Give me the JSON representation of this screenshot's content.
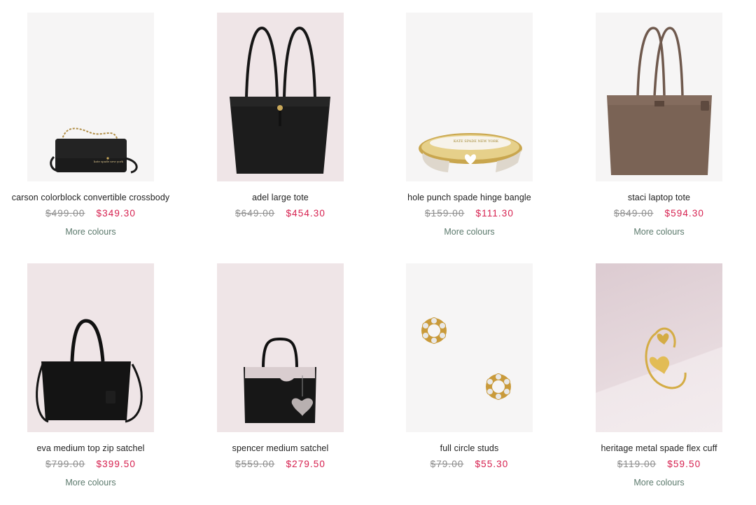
{
  "products": [
    {
      "name": "carson colorblock convertible crossbody",
      "original_price": "$499.00",
      "sale_price": "$349.30",
      "more_colours": "More colours",
      "bag_logo": "kate spade new york"
    },
    {
      "name": "adel large tote",
      "original_price": "$649.00",
      "sale_price": "$454.30",
      "more_colours": ""
    },
    {
      "name": "hole punch spade hinge bangle",
      "original_price": "$159.00",
      "sale_price": "$111.30",
      "more_colours": "More colours",
      "bag_logo": "KATE SPADE NEW YORK"
    },
    {
      "name": "staci laptop tote",
      "original_price": "$849.00",
      "sale_price": "$594.30",
      "more_colours": "More colours"
    },
    {
      "name": "eva medium top zip satchel",
      "original_price": "$799.00",
      "sale_price": "$399.50",
      "more_colours": "More colours"
    },
    {
      "name": "spencer medium satchel",
      "original_price": "$559.00",
      "sale_price": "$279.50",
      "more_colours": ""
    },
    {
      "name": "full circle studs",
      "original_price": "$79.00",
      "sale_price": "$55.30",
      "more_colours": ""
    },
    {
      "name": "heritage metal spade flex cuff",
      "original_price": "$119.00",
      "sale_price": "$59.50",
      "more_colours": "More colours"
    }
  ],
  "colors": {
    "sale": "#d6204f",
    "original": "#8c8c8c",
    "more_link": "#5c7a6d"
  }
}
